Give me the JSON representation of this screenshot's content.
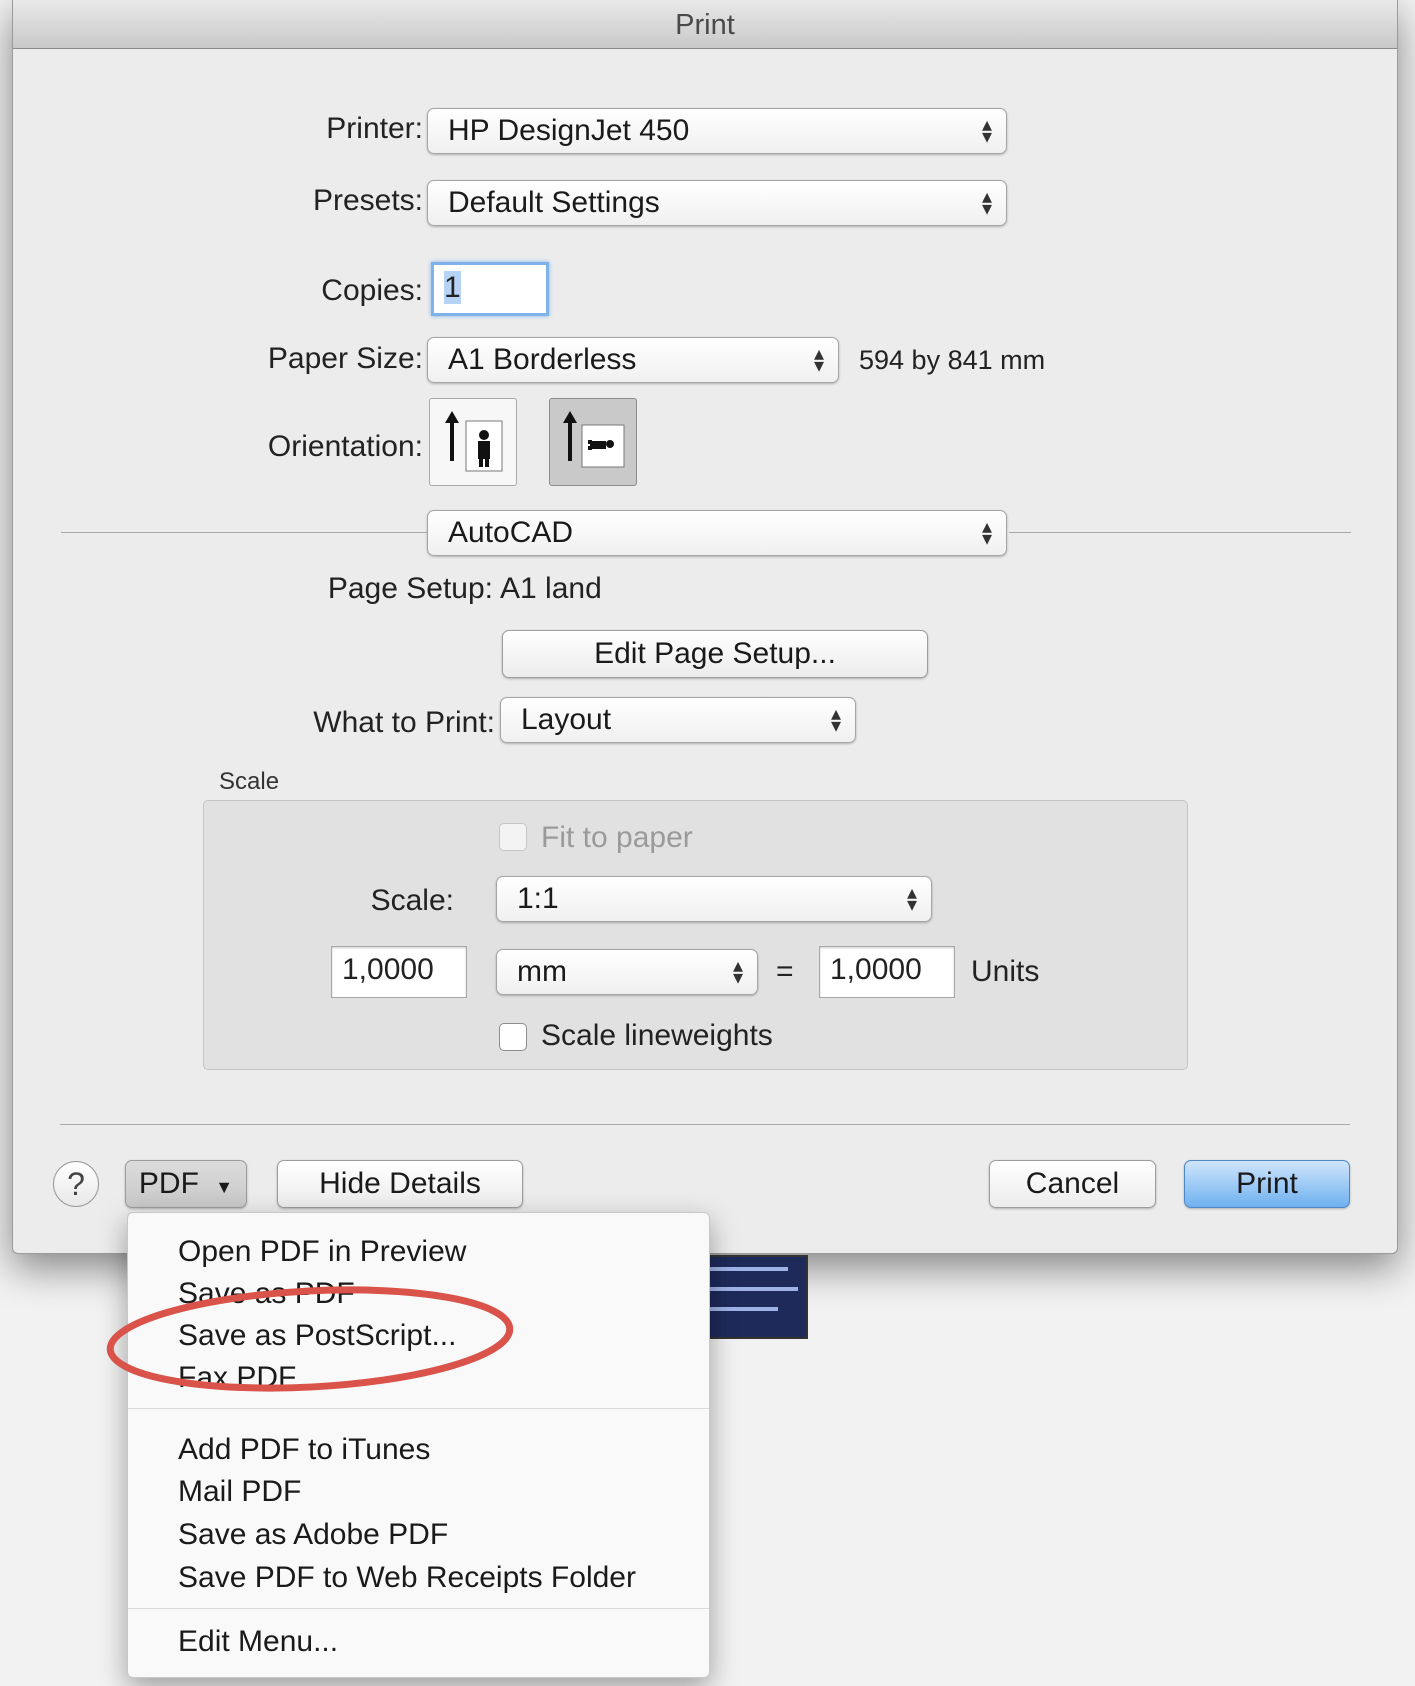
{
  "window": {
    "title": "Print"
  },
  "printer": {
    "label": "Printer:",
    "value": "HP DesignJet 450"
  },
  "presets": {
    "label": "Presets:",
    "value": "Default Settings"
  },
  "copies": {
    "label": "Copies:",
    "value": "1"
  },
  "paper_size": {
    "label": "Paper Size:",
    "value": "A1 Borderless",
    "dimensions": "594 by 841 mm"
  },
  "orientation": {
    "label": "Orientation:",
    "selected": "landscape"
  },
  "pane_selector": {
    "value": "AutoCAD"
  },
  "page_setup": {
    "label": "Page Setup:",
    "value": "A1 land",
    "edit_button": "Edit Page Setup..."
  },
  "what_to_print": {
    "label": "What to Print:",
    "value": "Layout"
  },
  "scale_group": {
    "title": "Scale",
    "fit_to_paper": "Fit to paper",
    "scale_label": "Scale:",
    "scale_value": "1:1",
    "left_value": "1,0000",
    "unit": "mm",
    "equals": "=",
    "right_value": "1,0000",
    "units_label": "Units",
    "scale_lineweights": "Scale lineweights"
  },
  "footer": {
    "help": "?",
    "pdf_button": "PDF",
    "hide_details": "Hide Details",
    "cancel": "Cancel",
    "print": "Print"
  },
  "pdf_menu": {
    "group1": [
      "Open PDF in Preview",
      "Save as PDF",
      "Save as PostScript...",
      "Fax PDF"
    ],
    "group2": [
      "Add PDF to iTunes",
      "Mail PDF",
      "Save as Adobe PDF",
      "Save PDF to Web Receipts Folder"
    ],
    "group3": [
      "Edit Menu..."
    ]
  },
  "colors": {
    "highlight_circle": "#d9534a",
    "default_button": "#6fb1f0"
  }
}
